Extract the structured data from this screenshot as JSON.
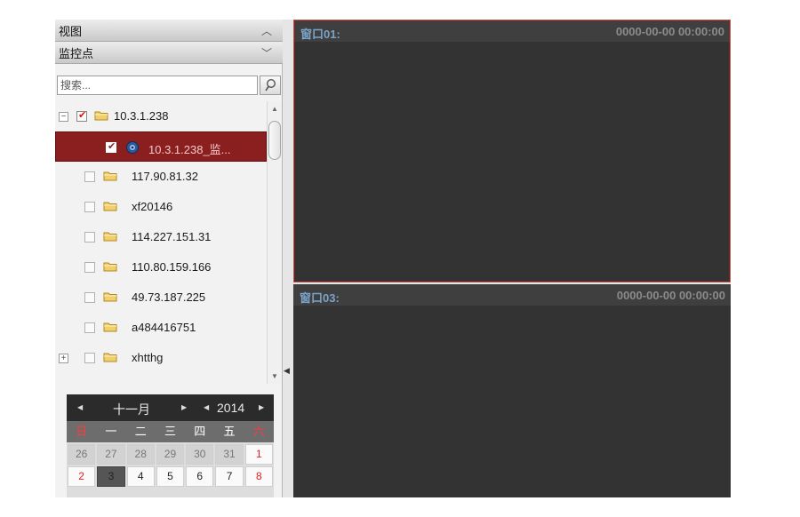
{
  "panels": {
    "view": {
      "title": "视图"
    },
    "points": {
      "title": "监控点"
    }
  },
  "search": {
    "placeholder": "搜索..."
  },
  "tree": {
    "root": {
      "label": "10.3.1.238",
      "checked": true,
      "expanded": true
    },
    "child": {
      "label": "10.3.1.238_监...",
      "checked": true,
      "selected": true
    },
    "items": [
      {
        "label": "117.90.81.32"
      },
      {
        "label": "xf20146"
      },
      {
        "label": "114.227.151.31"
      },
      {
        "label": "110.80.159.166"
      },
      {
        "label": "49.73.187.225"
      },
      {
        "label": "a484416751"
      },
      {
        "label": "xhtthg"
      }
    ]
  },
  "calendar": {
    "month": "十一月",
    "year": "2014",
    "weekdays": [
      "日",
      "一",
      "二",
      "三",
      "四",
      "五",
      "六"
    ],
    "rows": [
      [
        "26",
        "27",
        "28",
        "29",
        "30",
        "31",
        "1"
      ],
      [
        "2",
        "3",
        "4",
        "5",
        "6",
        "7",
        "8"
      ]
    ]
  },
  "windows": [
    {
      "name": "窗口01:",
      "time": "0000-00-00 00:00:00"
    },
    {
      "name": "窗口03:",
      "time": "0000-00-00 00:00:00"
    }
  ],
  "colors": {
    "selected_row": "#8b1f1f",
    "active_window_border": "#d44a3f",
    "window_title": "#7aa3c9",
    "weekend": "#ff3b3b"
  }
}
